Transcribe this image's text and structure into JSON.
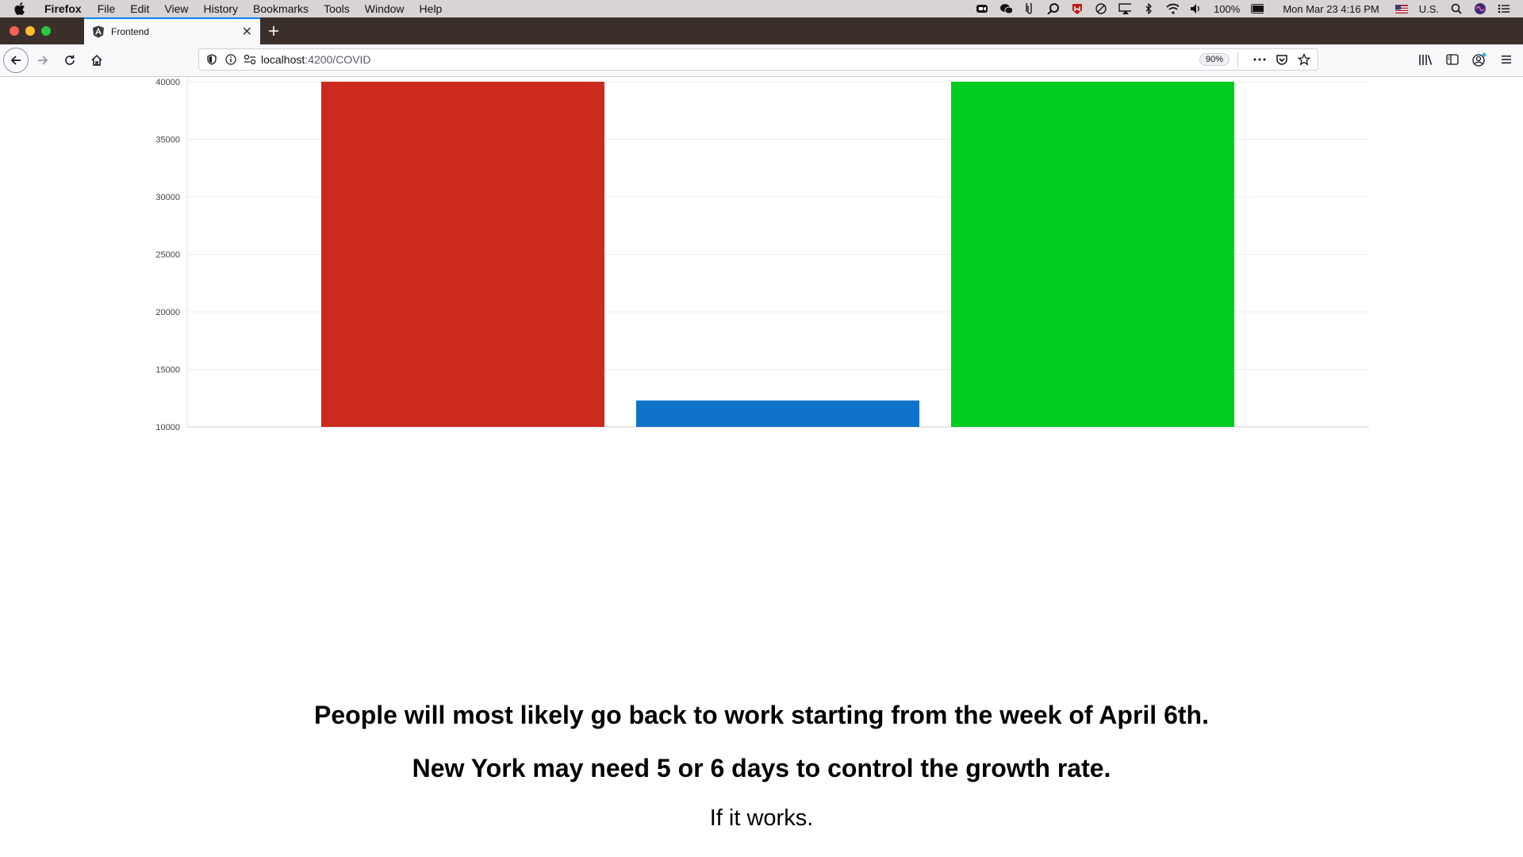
{
  "menubar": {
    "app_name": "Firefox",
    "items": [
      "File",
      "Edit",
      "View",
      "History",
      "Bookmarks",
      "Tools",
      "Window",
      "Help"
    ],
    "battery": "100%",
    "clock": "Mon Mar 23  4:16 PM",
    "input_source": "U.S.",
    "status_icons": [
      "zoom-icon",
      "wechat-icon",
      "paperclip-icon",
      "magnifier-icon",
      "mcafee-icon",
      "circle-icon",
      "airplay-icon",
      "bluetooth-icon",
      "wifi-icon",
      "volume-icon",
      "battery-icon",
      "flag-icon",
      "spotlight-icon",
      "siri-icon",
      "notification-center-icon"
    ]
  },
  "tab": {
    "title": "Frontend",
    "favicon": "angular-icon"
  },
  "navbar": {
    "url_host": "localhost",
    "url_path": ":4200/COVID",
    "zoom": "90%"
  },
  "chart_data": {
    "type": "bar",
    "categories": [
      "",
      "",
      ""
    ],
    "values": [
      40000,
      12300,
      40000
    ],
    "colors": [
      "#cc2a1e",
      "#0e73c9",
      "#00cc1f"
    ],
    "ylim": [
      10000,
      40000
    ],
    "yticks": [
      "10000",
      "15000",
      "20000",
      "25000",
      "30000",
      "35000",
      "40000"
    ],
    "grid": true,
    "title": "",
    "xlabel": "",
    "ylabel": ""
  },
  "message": {
    "line1": "People will most likely go back to work starting from the week of April 6th.",
    "line2": "New York may need 5 or 6 days to control the growth rate.",
    "line3": "If it works."
  }
}
